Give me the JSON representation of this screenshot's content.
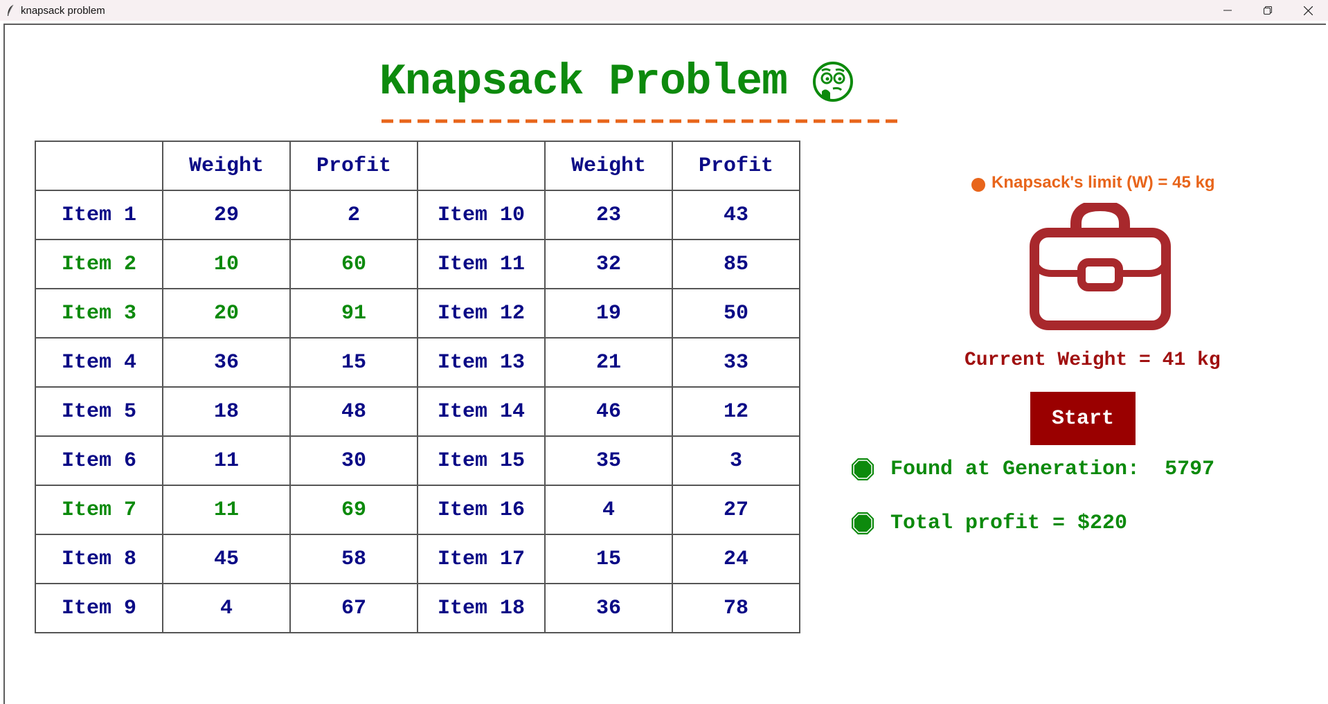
{
  "window": {
    "title": "knapsack problem"
  },
  "heading": {
    "title": "Knapsack Problem",
    "emoji_icon": "thinking-face-icon",
    "underline": "--------------------------"
  },
  "table": {
    "headers": [
      "",
      "Weight",
      "Profit",
      "",
      "Weight",
      "Profit"
    ],
    "rows": [
      {
        "item_a": "Item 1",
        "weight_a": "29",
        "profit_a": "2",
        "item_b": "Item 10",
        "weight_b": "23",
        "profit_b": "43",
        "selected_a": false
      },
      {
        "item_a": "Item 2",
        "weight_a": "10",
        "profit_a": "60",
        "item_b": "Item 11",
        "weight_b": "32",
        "profit_b": "85",
        "selected_a": true
      },
      {
        "item_a": "Item 3",
        "weight_a": "20",
        "profit_a": "91",
        "item_b": "Item 12",
        "weight_b": "19",
        "profit_b": "50",
        "selected_a": true
      },
      {
        "item_a": "Item 4",
        "weight_a": "36",
        "profit_a": "15",
        "item_b": "Item 13",
        "weight_b": "21",
        "profit_b": "33",
        "selected_a": false
      },
      {
        "item_a": "Item 5",
        "weight_a": "18",
        "profit_a": "48",
        "item_b": "Item 14",
        "weight_b": "46",
        "profit_b": "12",
        "selected_a": false
      },
      {
        "item_a": "Item 6",
        "weight_a": "11",
        "profit_a": "30",
        "item_b": "Item 15",
        "weight_b": "35",
        "profit_b": "3",
        "selected_a": false
      },
      {
        "item_a": "Item 7",
        "weight_a": "11",
        "profit_a": "69",
        "item_b": "Item 16",
        "weight_b": "4",
        "profit_b": "27",
        "selected_a": true
      },
      {
        "item_a": "Item 8",
        "weight_a": "45",
        "profit_a": "58",
        "item_b": "Item 17",
        "weight_b": "15",
        "profit_b": "24",
        "selected_a": false
      },
      {
        "item_a": "Item 9",
        "weight_a": "4",
        "profit_a": "67",
        "item_b": "Item 18",
        "weight_b": "36",
        "profit_b": "78",
        "selected_a": false
      }
    ]
  },
  "panel": {
    "limit_label": "Knapsack's limit (W) = 45 kg",
    "current_weight": "Current Weight = 41 kg",
    "start_label": "Start",
    "generation_label": "Found at Generation:  5797",
    "profit_label": "Total profit = $220"
  },
  "colors": {
    "green": "#0d8a0d",
    "navy": "#0b0b86",
    "orange": "#e8651b",
    "dark_red": "#9a0000",
    "bag_red": "#a8282c"
  }
}
